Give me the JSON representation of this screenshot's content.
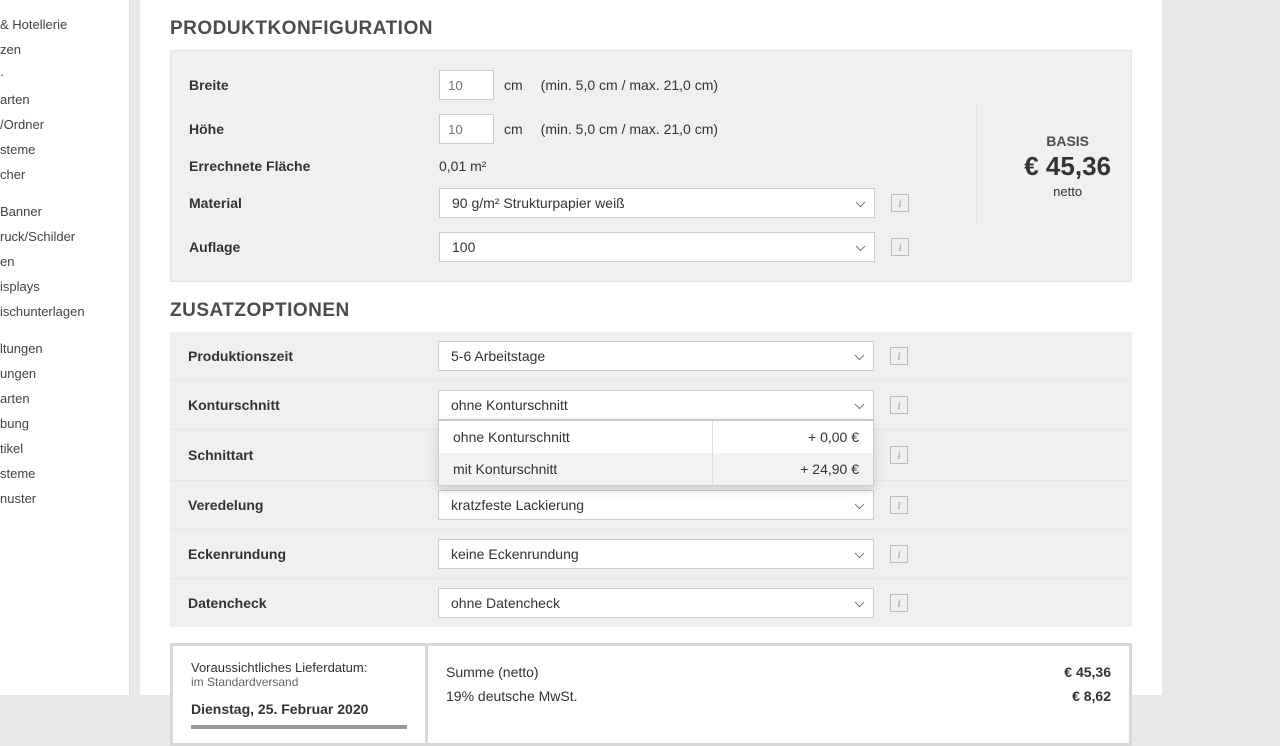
{
  "sidebar": {
    "items": [
      "& Hotellerie",
      "zen",
      "·",
      "arten",
      "/Ordner",
      "steme",
      "cher",
      "",
      "Banner",
      "ruck/Schilder",
      "en",
      "isplays",
      "ischunterlagen",
      "",
      "ltungen",
      "ungen",
      "arten",
      "bung",
      "tikel",
      "steme",
      "nuster"
    ]
  },
  "config": {
    "title": "PRODUKTKONFIGURATION",
    "breite": {
      "label": "Breite",
      "value": "10",
      "unit": "cm",
      "range": "(min. 5,0 cm / max. 21,0 cm)"
    },
    "hoehe": {
      "label": "Höhe",
      "value": "10",
      "unit": "cm",
      "range": "(min. 5,0 cm / max. 21,0 cm)"
    },
    "flaeche": {
      "label": "Errechnete Fläche",
      "value": "0,01 m²"
    },
    "material": {
      "label": "Material",
      "value": "90 g/m² Strukturpapier weiß"
    },
    "auflage": {
      "label": "Auflage",
      "value": "100"
    },
    "price": {
      "label": "BASIS",
      "amount": "€ 45,36",
      "sub": "netto"
    }
  },
  "options": {
    "title": "ZUSATZOPTIONEN",
    "prod": {
      "label": "Produktionszeit",
      "value": "5-6 Arbeitstage"
    },
    "kontur": {
      "label": "Konturschnitt",
      "value": "ohne Konturschnitt",
      "menu": [
        {
          "name": "ohne Konturschnitt",
          "price": "+ 0,00 €"
        },
        {
          "name": "mit Konturschnitt",
          "price": "+ 24,90 €"
        }
      ]
    },
    "schnitt": {
      "label": "Schnittart"
    },
    "vered": {
      "label": "Veredelung",
      "value": "kratzfeste Lackierung"
    },
    "ecken": {
      "label": "Eckenrundung",
      "value": "keine Eckenrundung"
    },
    "daten": {
      "label": "Datencheck",
      "value": "ohne Datencheck"
    }
  },
  "summary": {
    "deliv_label": "Voraussichtliches Lieferdatum:",
    "deliv_sub": "im Standardversand",
    "deliv_date": "Dienstag, 25. Februar 2020",
    "netto": {
      "label": "Summe (netto)",
      "value": "€ 45,36"
    },
    "mwst": {
      "label": "19% deutsche MwSt.",
      "value": "€ 8,62"
    }
  }
}
